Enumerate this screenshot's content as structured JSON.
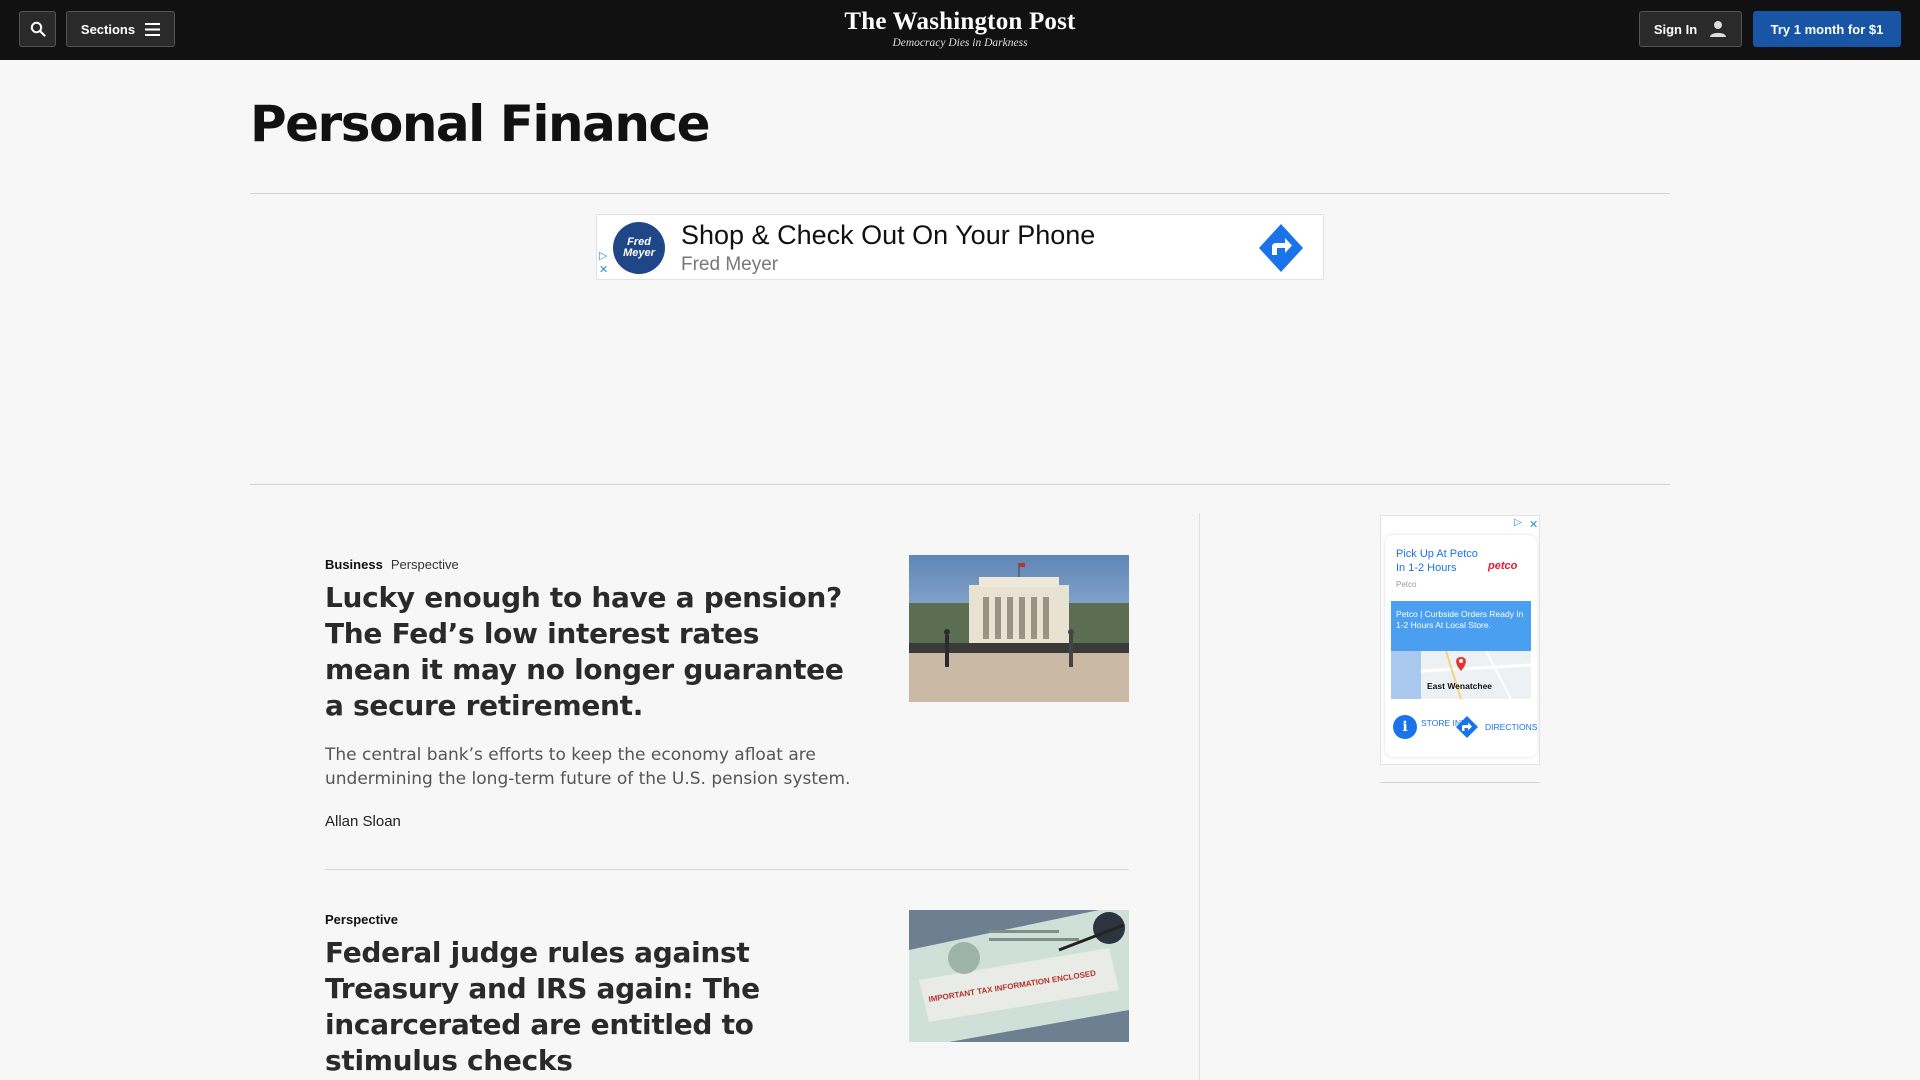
{
  "header": {
    "sections_label": "Sections",
    "logo_name": "The Washington Post",
    "logo_tagline": "Democracy Dies in Darkness",
    "signin_label": "Sign In",
    "subscribe_label": "Try 1 month for $1"
  },
  "page": {
    "title": "Personal Finance"
  },
  "banner_ad": {
    "logo_text": "Fred Meyer",
    "headline": "Shop & Check Out On Your Phone",
    "advertiser": "Fred Meyer"
  },
  "stories": [
    {
      "section": "Business",
      "label": "Perspective",
      "headline": "Lucky enough to have a pension? The Fed’s low interest rates mean it may no longer guarantee a secure retirement.",
      "blurb": "The central bank’s efforts to keep the economy afloat are undermining the long-term future of the U.S. pension system.",
      "byline": "Allan Sloan"
    },
    {
      "section": "Perspective",
      "label": "",
      "headline": "Federal judge rules against Treasury and IRS again: The incarcerated are entitled to stimulus checks",
      "image_text": "IMPORTANT TAX INFORMATION ENCLOSED"
    }
  ],
  "side_ad": {
    "headline": "Pick Up At Petco In 1-2 Hours",
    "brand": "petco",
    "advertiser": "Petco",
    "box_text": "Petco | Curbside Orders Ready In 1-2 Hours At Local Store.",
    "map_label": "East Wenatchee",
    "store_info": "STORE INFO",
    "directions": "DIRECTIONS"
  },
  "colors": {
    "topbar": "#111111",
    "subscribe": "#1955a5",
    "page_bg": "#f7f7f7",
    "ad_blue": "#1a73e8"
  }
}
